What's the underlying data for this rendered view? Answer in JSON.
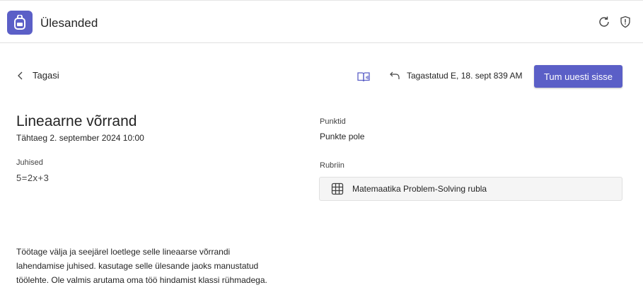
{
  "header": {
    "app_title": "Ülesanded",
    "app_icon": "backpack-icon",
    "refresh_icon": "refresh-icon",
    "shield_icon": "shield-icon",
    "accent_color": "#5b5fc7"
  },
  "toolbar": {
    "back_label": "Tagasi",
    "immersive_reader_icon": "immersive-reader-icon",
    "returned_text": "Tagastatud E, 18. sept 839 AM",
    "turn_in_label": "Tum uuesti sisse"
  },
  "assignment": {
    "title": "Lineaarne võrrand",
    "due": "Tähtaeg 2. september 2024 10:00",
    "instructions_label": "Juhised",
    "instructions_equation": "5=2x+3",
    "description_lines": [
      "Töötage välja ja seejärel loetlege selle lineaarse võrrandi",
      "lahendamise juhised. kasutage selle ülesande jaoks manustatud",
      "töölehte. Ole valmis arutama oma töö hindamist klassi rühmadega."
    ]
  },
  "points": {
    "label": "Punktid",
    "value": "Punkte pole"
  },
  "rubric": {
    "label": "Rubriin",
    "name": "Matemaatika Problem-Solving rubla",
    "icon": "grid-icon"
  }
}
